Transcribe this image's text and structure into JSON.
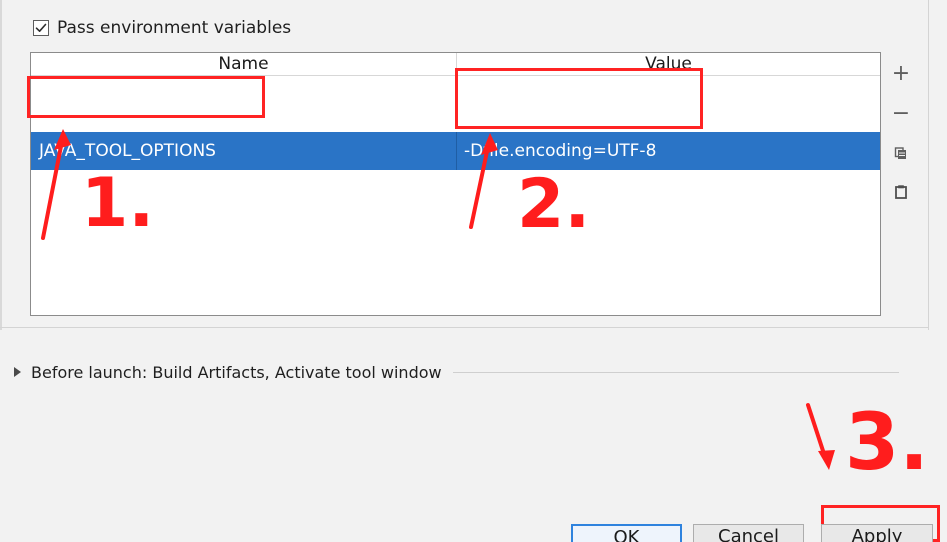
{
  "options": {
    "pass_env_label": "Pass environment variables",
    "pass_env_checked": true
  },
  "table": {
    "headers": [
      "Name",
      "Value"
    ],
    "rows": [
      {
        "name": "JAVA_TOOL_OPTIONS",
        "value": "-Dfile.encoding=UTF-8"
      }
    ]
  },
  "toolbar": {
    "add_icon": "plus-icon",
    "remove_icon": "minus-icon",
    "copy_icon": "copy-icon",
    "paste_icon": "clipboard-icon"
  },
  "before_launch": {
    "label": "Before launch: Build Artifacts, Activate tool window"
  },
  "buttons": {
    "ok": "OK",
    "cancel": "Cancel",
    "apply": "Apply"
  },
  "annotations": {
    "label_1": "1.",
    "label_2": "2.",
    "label_3": "3."
  },
  "colors": {
    "selection": "#2a74c6",
    "annotation_red": "#ff2323",
    "ok_border": "#2f83de"
  }
}
